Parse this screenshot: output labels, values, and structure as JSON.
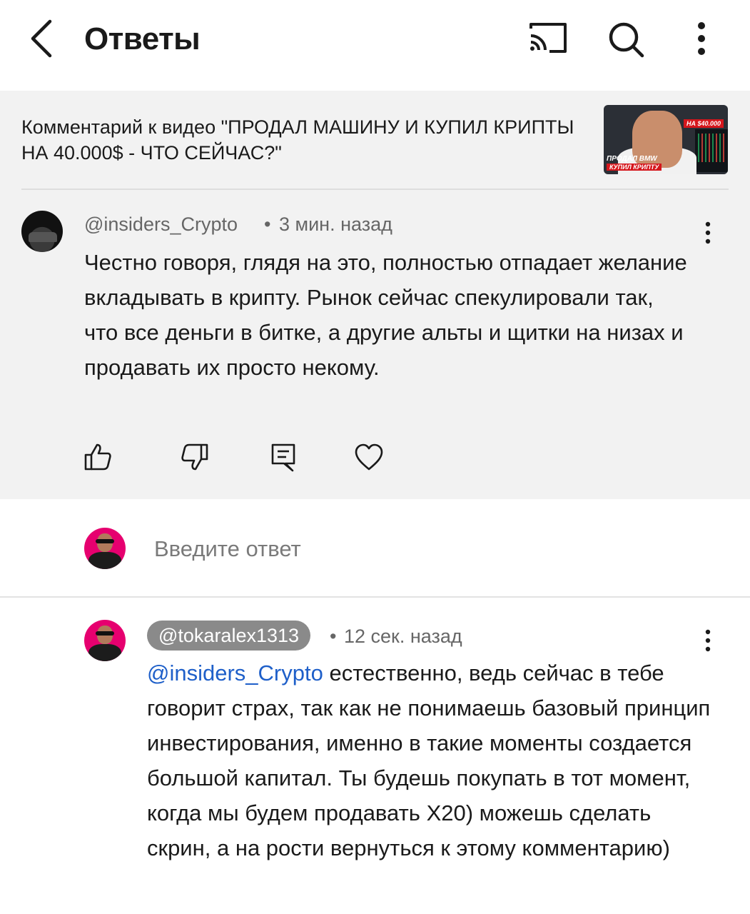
{
  "header": {
    "title": "Ответы",
    "icons": [
      "back-arrow-icon",
      "cast-icon",
      "search-icon",
      "more-vert-icon"
    ]
  },
  "parent_comment": {
    "video_title": "Комментарий к видео \"ПРОДАЛ МАШИНУ И КУПИЛ КРИПТЫ НА 40.000$ - ЧТО СЕЙЧАС?\"",
    "thumbnail": {
      "tag_top": "НА $40.000",
      "line1": "ПРОДАЛ BMW",
      "line2": "КУПИЛ КРИПТУ"
    },
    "author": "@insiders_Crypto",
    "separator": "•",
    "time": "3 мин. назад",
    "text": "Честно говоря, глядя на это, полностью отпадает желание вкладывать в крипту. Рынок сейчас спекулировали так, что все деньги в битке, а другие альты и щитки на низах и продавать их просто некому.",
    "actions": [
      "like-icon",
      "dislike-icon",
      "reply-icon",
      "heart-icon"
    ]
  },
  "reply_box": {
    "placeholder": "Введите ответ"
  },
  "reply": {
    "author": "@tokaralex1313",
    "separator": "•",
    "time": "12 сек. назад",
    "mention": "@insiders_Crypto",
    "text": " естественно, ведь сейчас в тебе говорит страх, так как не понимаешь базовый принцип инвестирования, именно в такие моменты создается большой капитал. Ты будешь покупать в тот момент, когда мы будем продавать X20) можешь сделать скрин, а на рости вернуться к этому комментарию)"
  },
  "colors": {
    "background": "#ffffff",
    "parent_background": "#f2f2f2",
    "mention": "#1e5fc9",
    "chip": "#8a8a8a",
    "avatar_accent": "#e6006f"
  }
}
